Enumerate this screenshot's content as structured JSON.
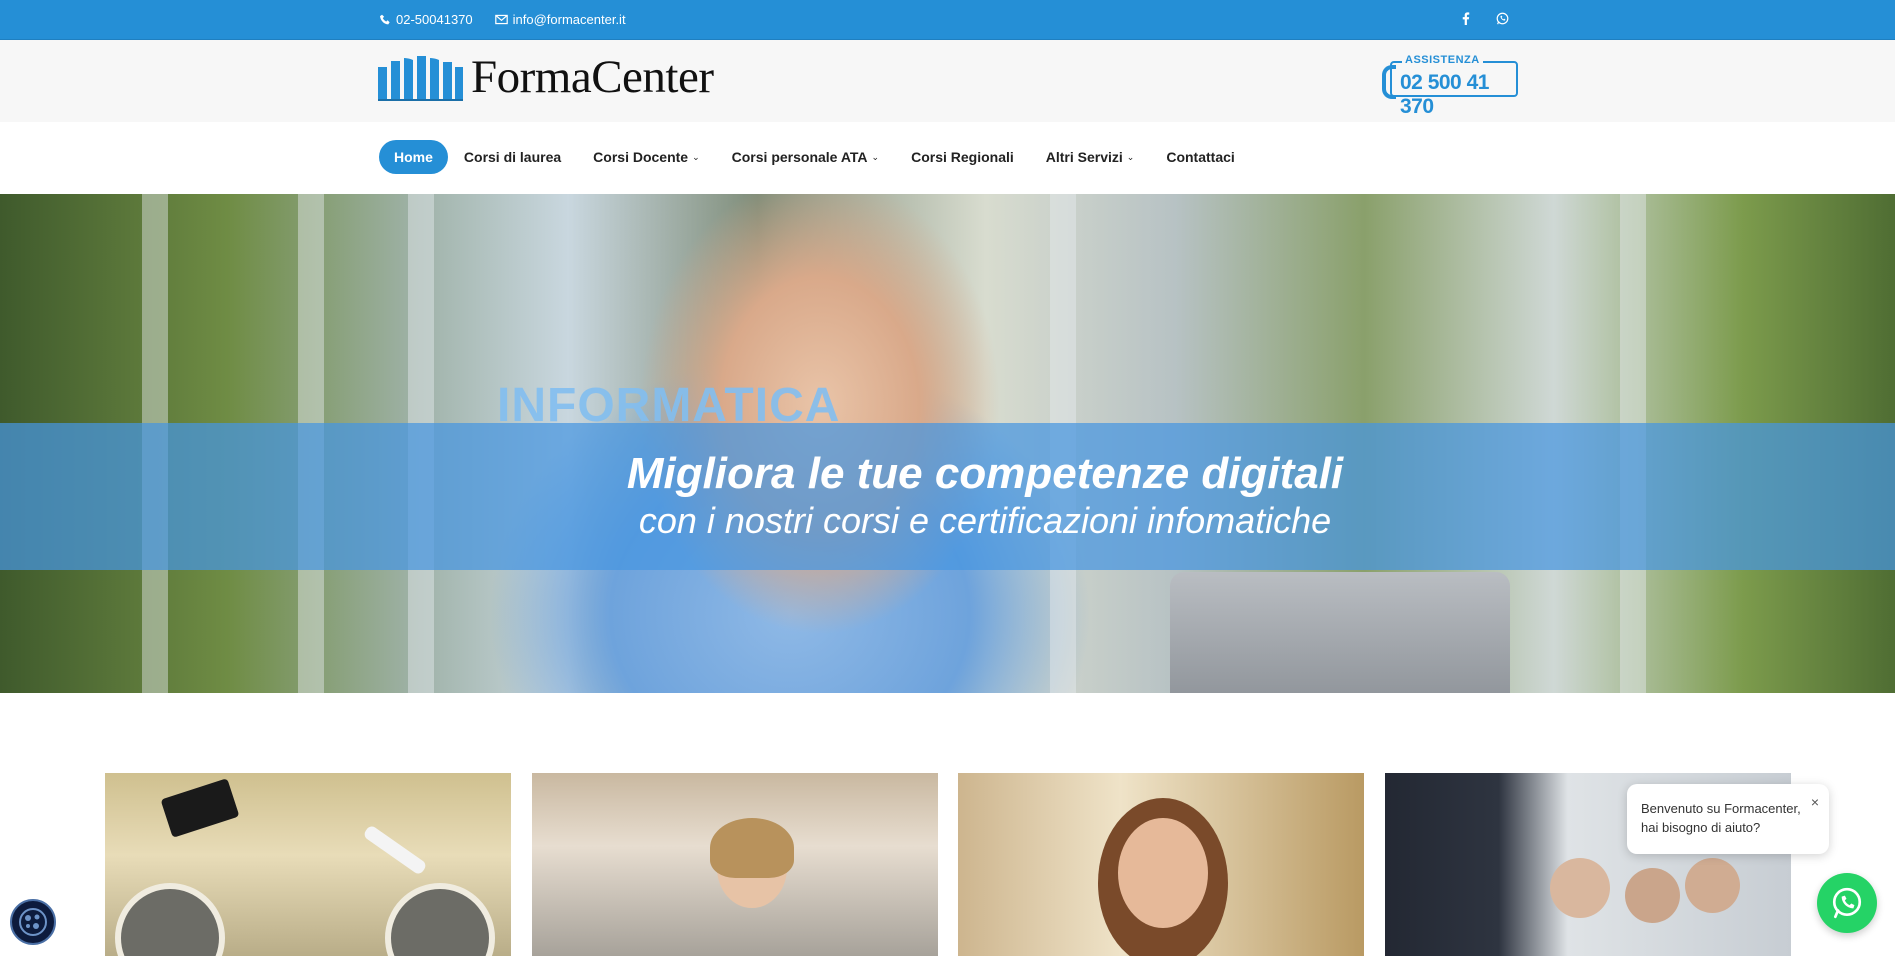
{
  "topbar": {
    "phone": "02-50041370",
    "email": "info@formacenter.it",
    "social": [
      "facebook-icon",
      "whatsapp-icon"
    ]
  },
  "header": {
    "logo_text": "FormaCenter",
    "assist_label": "ASSISTENZA",
    "assist_number": "02 500 41 370"
  },
  "nav": {
    "items": [
      {
        "label": "Home",
        "active": true
      },
      {
        "label": "Corsi di laurea"
      },
      {
        "label": "Corsi Docente",
        "dropdown": true
      },
      {
        "label": "Corsi personale ATA",
        "dropdown": true
      },
      {
        "label": "Corsi Regionali"
      },
      {
        "label": "Altri Servizi",
        "dropdown": true
      },
      {
        "label": "Contattaci"
      }
    ]
  },
  "hero": {
    "tag": "INFORMATICA",
    "line1": "Migliora le tue competenze digitali",
    "line2": "con i nostri corsi e certificazioni infomatiche"
  },
  "chat": {
    "message": "Benvenuto su Formacenter, hai bisogno di aiuto?",
    "close": "×"
  },
  "colors": {
    "brand": "#258fd6",
    "whatsapp": "#25d366"
  }
}
